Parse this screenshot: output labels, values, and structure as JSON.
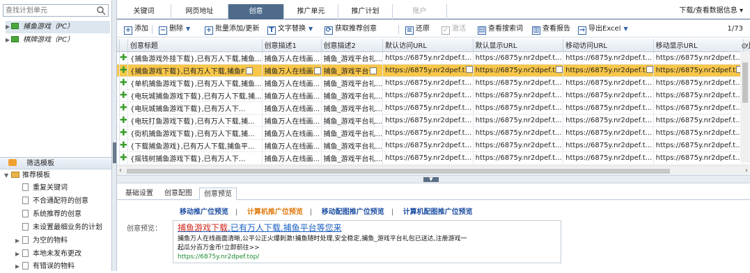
{
  "left": {
    "search_placeholder": "查找计划单元",
    "tree": [
      {
        "label": "捕鱼游戏（PC）",
        "selected": true
      },
      {
        "label": "棋牌游戏（PC）",
        "selected": false
      }
    ],
    "filter_title": "筛选模板",
    "filter_group": "推荐模板",
    "filter_items": [
      "重复关键词",
      "不合通配符的创意",
      "系统推荐的创意",
      "未设置最细业务的计划"
    ],
    "folders": [
      "为空的物料",
      "本地未发布更改",
      "有错误的物料"
    ]
  },
  "tabs": [
    {
      "label": "关键词",
      "state": "normal"
    },
    {
      "label": "网页地址",
      "state": "normal"
    },
    {
      "label": "创意",
      "state": "active"
    },
    {
      "label": "推广单元",
      "state": "normal"
    },
    {
      "label": "推广计划",
      "state": "normal"
    },
    {
      "label": "账户",
      "state": "disabled"
    }
  ],
  "download_info": "下载/查看数据信息 ▾",
  "toolbar": {
    "add": "添加",
    "delete": "删除",
    "batch_add": "批量添加/更新",
    "text_replace": "文字替换",
    "get_recommend": "获取推荐创意",
    "restore": "还原",
    "activate": "激活",
    "view_search_terms": "查看搜索词",
    "view_report": "查看报告",
    "export_excel": "导出Excel",
    "page_info": "1/73"
  },
  "columns": [
    "创意标题",
    "创意描述1",
    "创意描述2",
    "默认访问URL",
    "默认显示URL",
    "移动访问URL",
    "移动显示URL",
    "小程序URL"
  ],
  "rows": [
    [
      "{捕鱼游戏外挂下载},已有万人下载,捕鱼...",
      "捕鱼万人在线画...",
      "捕鱼_游戏平台礼...",
      "https://6875y.nr2dpef.t...",
      "https://6875y.nr2dpef.t...",
      "https://6875y.nr2dpef.t...",
      "https://6875y.nr2dpef.t...",
      ""
    ],
    [
      "{捕鱼游戏下载},已有万人下载,捕鱼F",
      "捕鱼万人在线画",
      "捕鱼_游戏平台",
      "https://6875y.nr2dpef.t",
      "https://6875y.nr2dpef.t",
      "https://6875y.nr2dpef.t",
      "https://6875y.nr2dpef.t",
      ""
    ],
    [
      "{单机捕鱼游戏下载},已有万人下载,捕鱼...",
      "捕鱼万人在线画...",
      "捕鱼_游戏平台礼...",
      "https://6875y.nr2dpef.t...",
      "https://6875y.nr2dpef.t...",
      "https://6875y.nr2dpef.t...",
      "https://6875y.nr2dpef.t...",
      ""
    ],
    [
      "{电玩城捕鱼游戏下载},已有万人下载,捕...",
      "捕鱼万人在线画...",
      "捕鱼_游戏平台礼...",
      "https://6875y.nr2dpef.t...",
      "https://6875y.nr2dpef.t...",
      "https://6875y.nr2dpef.t...",
      "https://6875y.nr2dpef.t...",
      ""
    ],
    [
      "{电玩城捕鱼游戏下载},已有万人下...",
      "捕鱼万人在线画...",
      "捕鱼_游戏平台礼...",
      "https://6875y.nr2dpef.t...",
      "https://6875y.nr2dpef.t...",
      "https://6875y.nr2dpef.t...",
      "https://6875y.nr2dpef.t...",
      ""
    ],
    [
      "{电玩打鱼游戏下载},已有万人下载,捕...",
      "捕鱼万人在线画...",
      "捕鱼_游戏平台礼...",
      "https://6875y.nr2dpef.t...",
      "https://6875y.nr2dpef.t...",
      "https://6875y.nr2dpef.t...",
      "https://6875y.nr2dpef.t...",
      ""
    ],
    [
      "{街机捕鱼游戏下载},已有万人下载,捕...",
      "捕鱼万人在线画...",
      "捕鱼_游戏平台礼...",
      "https://6875y.nr2dpef.t...",
      "https://6875y.nr2dpef.t...",
      "https://6875y.nr2dpef.t...",
      "https://6875y.nr2dpef.t...",
      ""
    ],
    [
      "{下载捕鱼游戏},已有万人下载,捕鱼平...",
      "捕鱼万人在线画...",
      "捕鱼_游戏平台礼...",
      "https://6875y.nr2dpef.t...",
      "https://6875y.nr2dpef.t...",
      "https://6875y.nr2dpef.t...",
      "https://6875y.nr2dpef.t...",
      ""
    ],
    [
      "{摇钱树捕鱼游戏下载},已有万人下...",
      "捕鱼万人在线画...",
      "捕鱼_游戏平台礼...",
      "https://6875y.nr2dpef.t...",
      "https://6875y.nr2dpef.t...",
      "https://6875y.nr2dpef.t...",
      "https://6875y.nr2dpef.t...",
      ""
    ]
  ],
  "selected_row": 1,
  "bottom_tabs": [
    "基础设置",
    "创意配图",
    "创意预览"
  ],
  "preview": {
    "links": [
      "移动推广位预览",
      "计算机推广位预览",
      "移动配图推广位预览",
      "计算机配图推广位预览"
    ],
    "active_link": 1,
    "label": "创意预览：",
    "title_kw": "捕鱼游戏下载",
    "title_rest": ",已有万人下载,捕鱼平台等您来",
    "desc": "捕鱼万人在线画面清晰,公平公正火爆刺激!捕鱼随时处理,安全稳定,捕鱼_游戏平台礼包已送达,注册游戏一起瓜分百万金币!立即前往>>",
    "url": "https://6875y.nr2dpef.top/"
  },
  "colors": {
    "accent": "#4e6b8c",
    "selected_row": "#f8c74a",
    "link": "#1a5fc0",
    "keyword": "#d0261c"
  }
}
